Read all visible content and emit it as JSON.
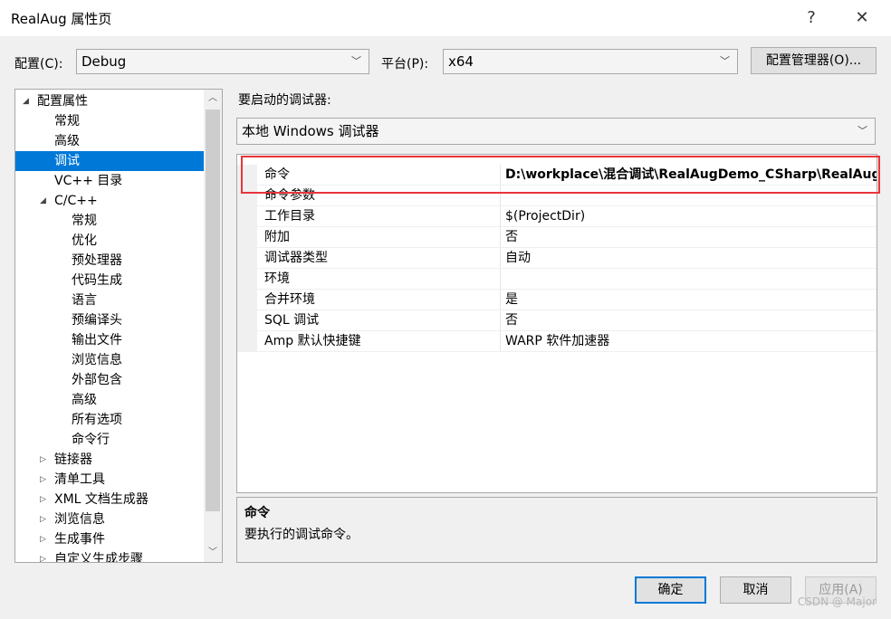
{
  "window": {
    "title": "RealAug 属性页",
    "help_glyph": "?",
    "close_glyph": "✕"
  },
  "config": {
    "label": "配置(C):",
    "value": "Debug"
  },
  "platform": {
    "label": "平台(P):",
    "value": "x64"
  },
  "config_manager_button": "配置管理器(O)...",
  "tree": {
    "items": [
      {
        "label": "配置属性",
        "arrow": "◢"
      },
      {
        "label": "常规"
      },
      {
        "label": "高级"
      },
      {
        "label": "调试"
      },
      {
        "label": "VC++ 目录"
      },
      {
        "label": "C/C++",
        "arrow": "◢"
      },
      {
        "label": "常规"
      },
      {
        "label": "优化"
      },
      {
        "label": "预处理器"
      },
      {
        "label": "代码生成"
      },
      {
        "label": "语言"
      },
      {
        "label": "预编译头"
      },
      {
        "label": "输出文件"
      },
      {
        "label": "浏览信息"
      },
      {
        "label": "外部包含"
      },
      {
        "label": "高级"
      },
      {
        "label": "所有选项"
      },
      {
        "label": "命令行"
      },
      {
        "label": "链接器",
        "arrow": "▷"
      },
      {
        "label": "清单工具",
        "arrow": "▷"
      },
      {
        "label": "XML 文档生成器",
        "arrow": "▷"
      },
      {
        "label": "浏览信息",
        "arrow": "▷"
      },
      {
        "label": "生成事件",
        "arrow": "▷"
      },
      {
        "label": "自定义生成步骤",
        "arrow": "▷"
      }
    ],
    "selected": "调试"
  },
  "debugger": {
    "section_label": "要启动的调试器:",
    "selected": "本地 Windows 调试器"
  },
  "properties": [
    {
      "name": "命令",
      "value": "D:\\workplace\\混合调试\\RealAugDemo_CSharp\\RealAug"
    },
    {
      "name": "命令参数",
      "value": ""
    },
    {
      "name": "工作目录",
      "value": "$(ProjectDir)"
    },
    {
      "name": "附加",
      "value": "否"
    },
    {
      "name": "调试器类型",
      "value": "自动"
    },
    {
      "name": "环境",
      "value": ""
    },
    {
      "name": "合并环境",
      "value": "是"
    },
    {
      "name": "SQL 调试",
      "value": "否"
    },
    {
      "name": "Amp 默认快捷键",
      "value": "WARP 软件加速器"
    }
  ],
  "description": {
    "title": "命令",
    "text": "要执行的调试命令。"
  },
  "buttons": {
    "ok": "确定",
    "cancel": "取消",
    "apply": "应用(A)"
  },
  "watermark": "CSDN @ Major",
  "colors": {
    "selection": "#0078d7",
    "highlight_box": "#e8353b"
  }
}
